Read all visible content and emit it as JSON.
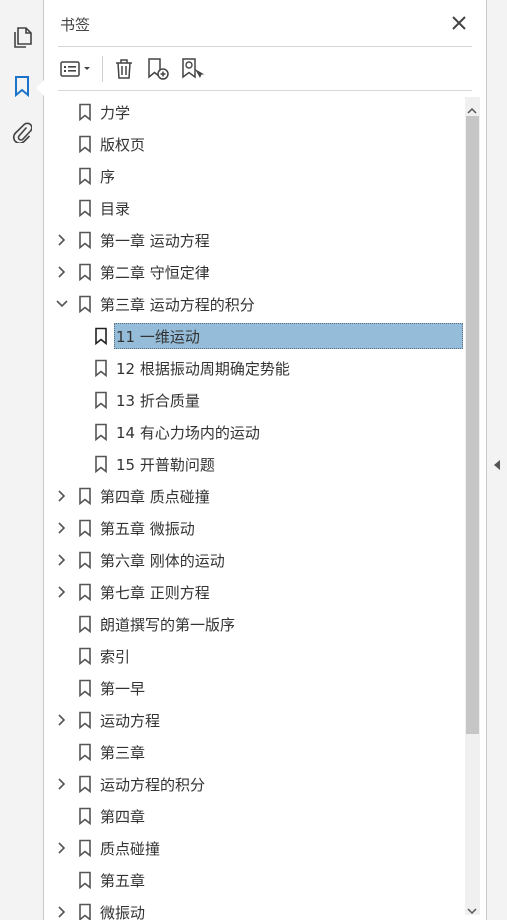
{
  "panel": {
    "title": "书签"
  },
  "icons": {
    "close": "close-icon",
    "options": "options-menu-icon",
    "delete": "trash-icon",
    "new": "new-bookmark-icon",
    "find": "find-current-bookmark-icon"
  },
  "colors": {
    "selection": "#95bcd8",
    "accent": "#1a73c8"
  },
  "bookmarks": [
    {
      "label": "力学",
      "level": 0,
      "expand": "none"
    },
    {
      "label": "版权页",
      "level": 0,
      "expand": "none"
    },
    {
      "label": "序",
      "level": 0,
      "expand": "none"
    },
    {
      "label": "目录",
      "level": 0,
      "expand": "none"
    },
    {
      "label": "第一章 运动方程",
      "level": 0,
      "expand": "collapsed"
    },
    {
      "label": "第二章 守恒定律",
      "level": 0,
      "expand": "collapsed"
    },
    {
      "label": "第三章 运动方程的积分",
      "level": 0,
      "expand": "expanded"
    },
    {
      "label": "11 一维运动",
      "level": 1,
      "expand": "none",
      "selected": true
    },
    {
      "label": "12 根据振动周期确定势能",
      "level": 1,
      "expand": "none"
    },
    {
      "label": "13 折合质量",
      "level": 1,
      "expand": "none"
    },
    {
      "label": "14 有心力场内的运动",
      "level": 1,
      "expand": "none"
    },
    {
      "label": "15 开普勒问题",
      "level": 1,
      "expand": "none"
    },
    {
      "label": "第四章 质点碰撞",
      "level": 0,
      "expand": "collapsed"
    },
    {
      "label": "第五章 微振动",
      "level": 0,
      "expand": "collapsed"
    },
    {
      "label": "第六章 刚体的运动",
      "level": 0,
      "expand": "collapsed"
    },
    {
      "label": "第七章 正则方程",
      "level": 0,
      "expand": "collapsed"
    },
    {
      "label": "朗道撰写的第一版序",
      "level": 0,
      "expand": "none"
    },
    {
      "label": "索引",
      "level": 0,
      "expand": "none"
    },
    {
      "label": "第一早",
      "level": 0,
      "expand": "none"
    },
    {
      "label": "运动方程",
      "level": 0,
      "expand": "collapsed"
    },
    {
      "label": "第三章",
      "level": 0,
      "expand": "none"
    },
    {
      "label": "运动方程的积分",
      "level": 0,
      "expand": "collapsed"
    },
    {
      "label": "第四章",
      "level": 0,
      "expand": "none"
    },
    {
      "label": "质点碰撞",
      "level": 0,
      "expand": "collapsed"
    },
    {
      "label": "第五章",
      "level": 0,
      "expand": "none"
    },
    {
      "label": "微振动",
      "level": 0,
      "expand": "collapsed"
    }
  ]
}
